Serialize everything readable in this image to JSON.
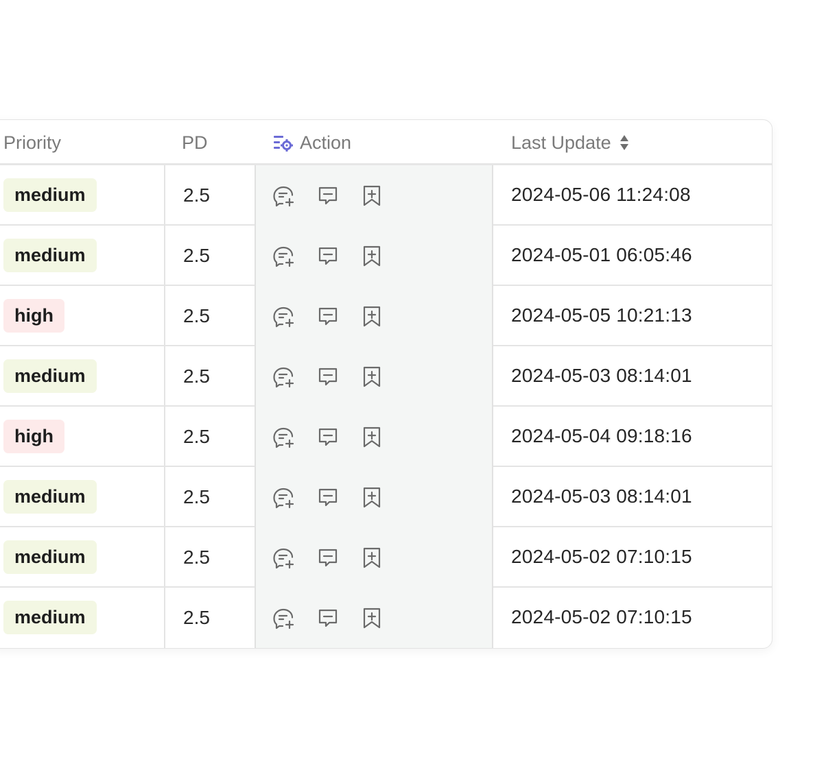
{
  "colors": {
    "medium_badge_bg": "#f3f7e3",
    "high_badge_bg": "#fdeaea",
    "action_column_bg": "#f4f6f5",
    "accent": "#6b6bd6"
  },
  "headers": {
    "priority": "Priority",
    "pd": "PD",
    "action": "Action",
    "last_update": "Last Update"
  },
  "rows": [
    {
      "priority": "medium",
      "pd": "2.5",
      "last_update": "2024-05-06 11:24:08"
    },
    {
      "priority": "medium",
      "pd": "2.5",
      "last_update": "2024-05-01 06:05:46"
    },
    {
      "priority": "high",
      "pd": "2.5",
      "last_update": "2024-05-05 10:21:13"
    },
    {
      "priority": "medium",
      "pd": "2.5",
      "last_update": "2024-05-03 08:14:01"
    },
    {
      "priority": "high",
      "pd": "2.5",
      "last_update": "2024-05-04 09:18:16"
    },
    {
      "priority": "medium",
      "pd": "2.5",
      "last_update": "2024-05-03 08:14:01"
    },
    {
      "priority": "medium",
      "pd": "2.5",
      "last_update": "2024-05-02 07:10:15"
    },
    {
      "priority": "medium",
      "pd": "2.5",
      "last_update": "2024-05-02 07:10:15"
    }
  ],
  "action_icons": [
    "add-comment-icon",
    "comment-icon",
    "bookmark-add-icon"
  ]
}
